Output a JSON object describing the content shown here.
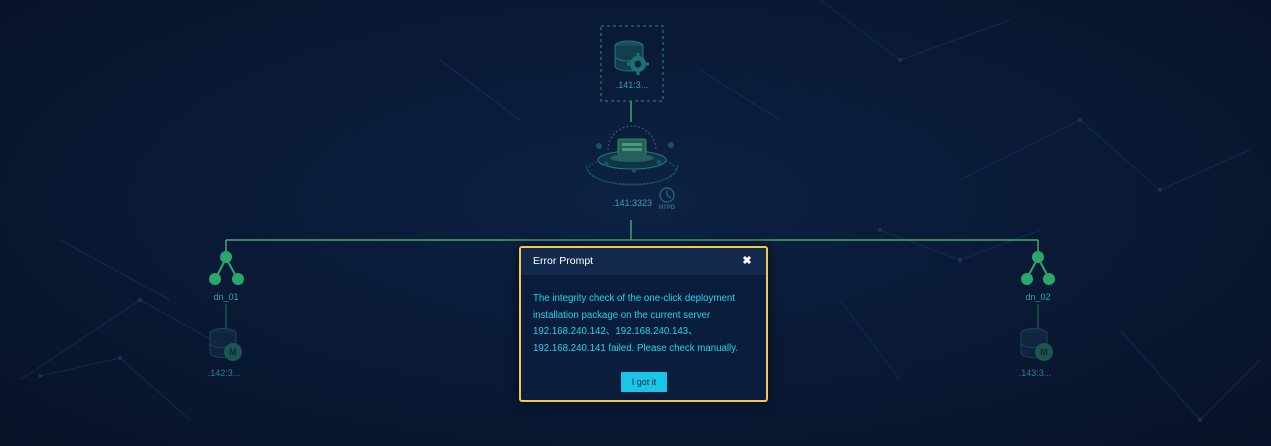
{
  "topology": {
    "gtm": {
      "label": ".141:3...",
      "icon": "database-gear-icon"
    },
    "cn": {
      "label": ".141:3323",
      "badge": "NTPD",
      "icon": "coordinator-node-icon"
    },
    "datanodes": [
      {
        "name": "dn_01",
        "master_label": ".142:3...",
        "master_badge": "M"
      },
      {
        "name": "dn_02",
        "master_label": ".143:3...",
        "master_badge": "M"
      }
    ]
  },
  "dialog": {
    "title": "Error Prompt",
    "close_icon": "close-icon",
    "message_lines": [
      "The integrity check of the one-click deployment",
      "installation package on the current server",
      "192.168.240.142、192.168.240.143、",
      "192.168.240.141 failed. Please check manually."
    ],
    "button_label": "I got it"
  },
  "colors": {
    "background": "#0a1a36",
    "link_line": "#5fbf7a",
    "node_green": "#2aa76a",
    "label_cyan": "#34a3c0",
    "dialog_border": "#f2c94c",
    "dialog_text": "#21d4ef",
    "button": "#19c6e8"
  }
}
